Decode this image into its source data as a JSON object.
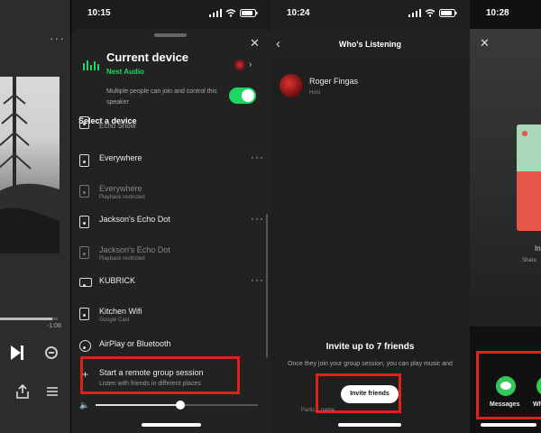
{
  "player": {
    "more_label": "···",
    "time_remaining": "-1:08",
    "progress": 0.9,
    "icons": [
      "play-next-icon",
      "remove-icon",
      "share-icon",
      "queue-icon"
    ]
  },
  "device_picker": {
    "time": "10:15",
    "current_title": "Current device",
    "current_device": "Nest Audio",
    "join_text": "Multiple people can join and control this speaker",
    "join_enabled": true,
    "select_label": "Select a device",
    "devices": [
      {
        "name": "Echo Show",
        "meta": "",
        "dim": false,
        "more": false,
        "icon": "speaker-icon"
      },
      {
        "name": "Everywhere",
        "meta": "",
        "dim": false,
        "more": true,
        "icon": "speaker-icon"
      },
      {
        "name": "Everywhere",
        "meta": "Playback restricted",
        "dim": true,
        "more": false,
        "icon": "speaker-icon"
      },
      {
        "name": "Jackson's Echo Dot",
        "meta": "",
        "dim": false,
        "more": true,
        "icon": "speaker-icon"
      },
      {
        "name": "Jackson's Echo Dot",
        "meta": "Playback restricted",
        "dim": true,
        "more": false,
        "icon": "speaker-icon"
      },
      {
        "name": "KUBRICK",
        "meta": "",
        "dim": false,
        "more": true,
        "icon": "laptop-icon"
      },
      {
        "name": "Kitchen Wifi",
        "meta": "Google Cast",
        "dim": false,
        "more": false,
        "icon": "speaker-icon"
      },
      {
        "name": "AirPlay or Bluetooth",
        "meta": "",
        "dim": false,
        "more": false,
        "icon": "airplay-icon"
      }
    ],
    "remote_title": "Start a remote group session",
    "remote_sub": "Listen with friends in different places",
    "volume": 0.52
  },
  "whos_listening": {
    "time": "10:24",
    "title": "Who's Listening",
    "host_name": "Roger Fingas",
    "host_role": "Host",
    "invite_title": "Invite up to 7 friends",
    "invite_desc": "Once they join your group session, you can play music and",
    "invite_button": "Invite friends",
    "footnote": "Partic... name."
  },
  "share_sheet": {
    "time": "10:28",
    "card_text": "Gr",
    "caption": "In",
    "caption_sub": "Share",
    "apps": [
      {
        "label": "Messages"
      },
      {
        "label": "Wh"
      }
    ]
  },
  "colors": {
    "accent": "#1ed760",
    "highlight": "#e0201a"
  }
}
